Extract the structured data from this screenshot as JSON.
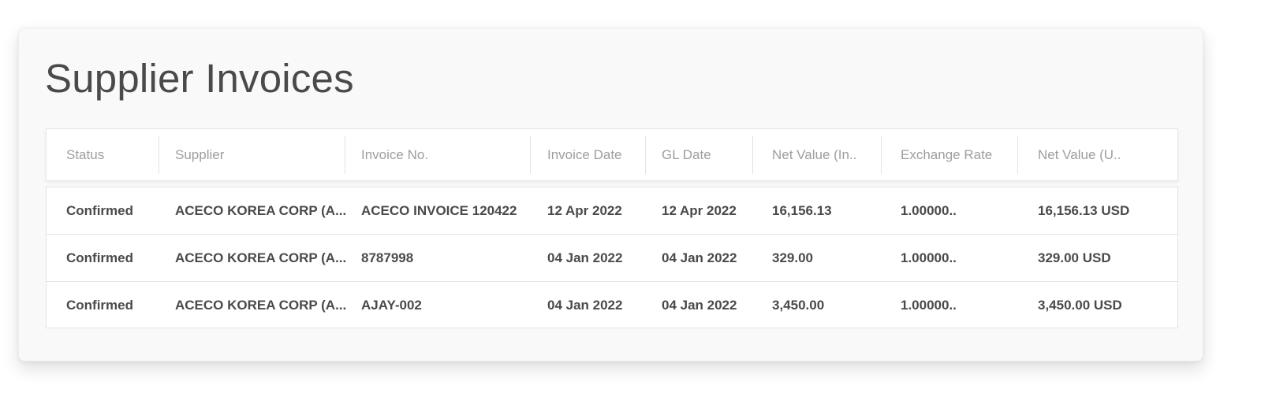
{
  "page": {
    "title": "Supplier Invoices"
  },
  "table": {
    "columns": [
      "Status",
      "Supplier",
      "Invoice No.",
      "Invoice Date",
      "GL Date",
      "Net Value (In..",
      "Exchange Rate",
      "Net Value (U.."
    ],
    "rows": [
      [
        "Confirmed",
        "ACECO KOREA CORP (A...",
        "ACECO INVOICE 120422",
        "12 Apr 2022",
        "12 Apr 2022",
        "16,156.13",
        "1.00000..",
        "16,156.13 USD"
      ],
      [
        "Confirmed",
        "ACECO KOREA CORP (A...",
        "8787998",
        "04 Jan 2022",
        "04 Jan 2022",
        "329.00",
        "1.00000..",
        "329.00 USD"
      ],
      [
        "Confirmed",
        "ACECO KOREA CORP (A...",
        "AJAY-002",
        "04 Jan 2022",
        "04 Jan 2022",
        "3,450.00",
        "1.00000..",
        "3,450.00 USD"
      ]
    ]
  },
  "colors": {
    "card_background": "#f9f9f9",
    "header_text": "#9e9e9e",
    "cell_text": "#4a4a4a",
    "title_text": "#4a4a4a",
    "border": "#e3e3e3"
  }
}
